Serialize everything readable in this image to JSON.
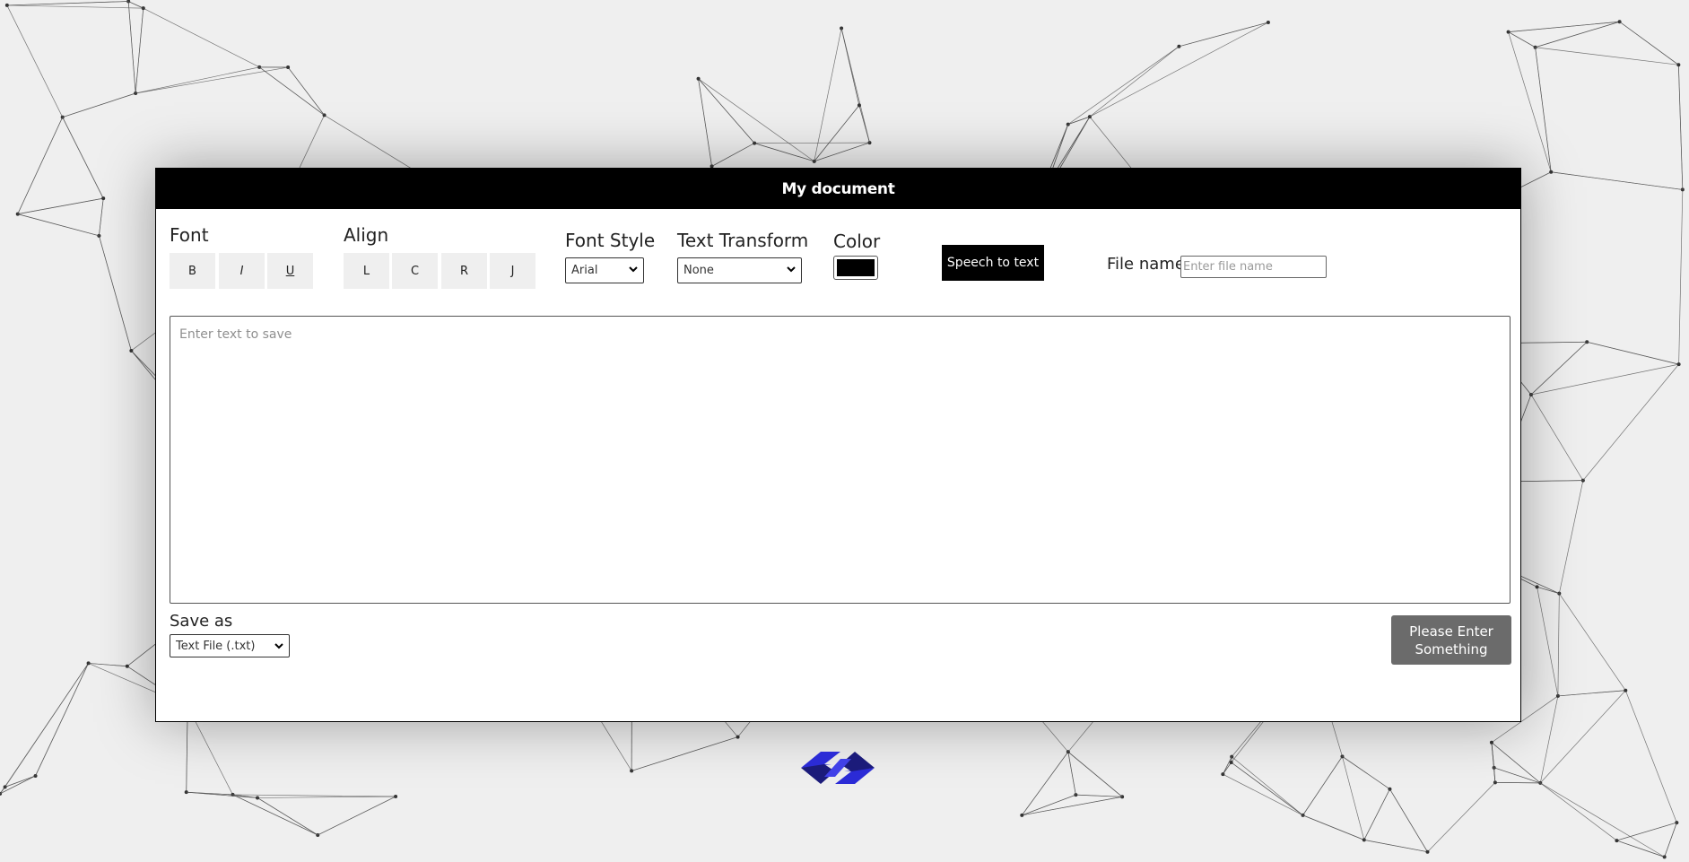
{
  "header": {
    "title": "My document"
  },
  "font_group": {
    "label": "Font",
    "buttons": [
      "B",
      "I",
      "U"
    ]
  },
  "align_group": {
    "label": "Align",
    "buttons": [
      "L",
      "C",
      "R",
      "J"
    ]
  },
  "font_style": {
    "label": "Font Style",
    "selected": "Arial"
  },
  "text_transform": {
    "label": "Text Transform",
    "selected": "None"
  },
  "color": {
    "label": "Color",
    "value": "#000000"
  },
  "speech_button": {
    "label": "Speech to text"
  },
  "file_name": {
    "label": "File name",
    "placeholder": "Enter file name"
  },
  "editor": {
    "placeholder": "Enter text to save"
  },
  "save_as": {
    "label": "Save as",
    "selected": "Text File (.txt)"
  },
  "submit_button": {
    "label": "Please Enter Something"
  },
  "colors": {
    "header_bg": "#000000",
    "submit_bg": "#6b6b6b",
    "logo_primary": "#2b2bd6",
    "logo_dark": "#1b1b7a"
  },
  "icons": {
    "select_arrow": "chevron-down-icon",
    "logo": "brand-logo-icon"
  }
}
